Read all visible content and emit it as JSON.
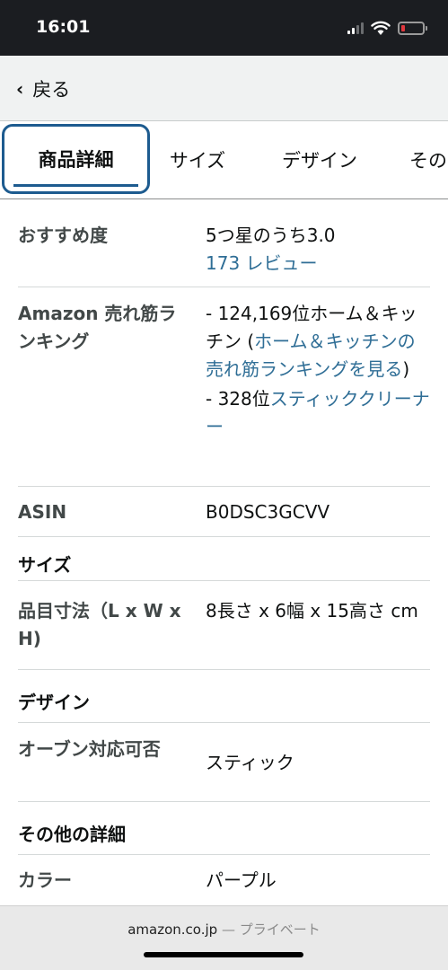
{
  "status_bar": {
    "time": "16:01",
    "icons": [
      "signal-icon",
      "wifi-icon",
      "battery-icon"
    ],
    "battery_color": "#e0383e"
  },
  "nav": {
    "back_label": "戻る",
    "back_icon": "chevron-left-icon"
  },
  "tabs": [
    {
      "label": "商品詳細",
      "active": true
    },
    {
      "label": "サイズ",
      "active": false
    },
    {
      "label": "デザイン",
      "active": false
    },
    {
      "label": "その",
      "active": false
    }
  ],
  "details": {
    "rating": {
      "label": "おすすめ度",
      "value": "5つ星のうち3.0",
      "reviews_link": "173 レビュー"
    },
    "ranking": {
      "label": "Amazon 売れ筋ランキング",
      "line1_text": "- 124,169位ホーム＆キッチン (",
      "line1_link": "ホーム＆キッチンの売れ筋ランキングを見る",
      "line1_suffix": ")",
      "line2_text": "- 328位",
      "line2_link": "スティッククリーナー"
    },
    "asin": {
      "label": "ASIN",
      "value": "B0DSC3GCVV"
    }
  },
  "size_section": {
    "title": "サイズ",
    "dimensions_label": "品目寸法（L x W x H)",
    "dimensions_value": "8長さ x 6幅 x 15高さ cm"
  },
  "design_section": {
    "title": "デザイン",
    "oven_label": "オーブン対応可否",
    "oven_value": "スティック"
  },
  "other_section": {
    "title": "その他の詳細",
    "color_label": "カラー",
    "color_value": "パープル"
  },
  "bottom_bar": {
    "domain": "amazon.co.jp",
    "privacy": "— プライベート"
  },
  "colors": {
    "link": "#2f6e96",
    "active_tab_border": "#1d5b8f",
    "status_bar_bg": "#1b1d21"
  }
}
